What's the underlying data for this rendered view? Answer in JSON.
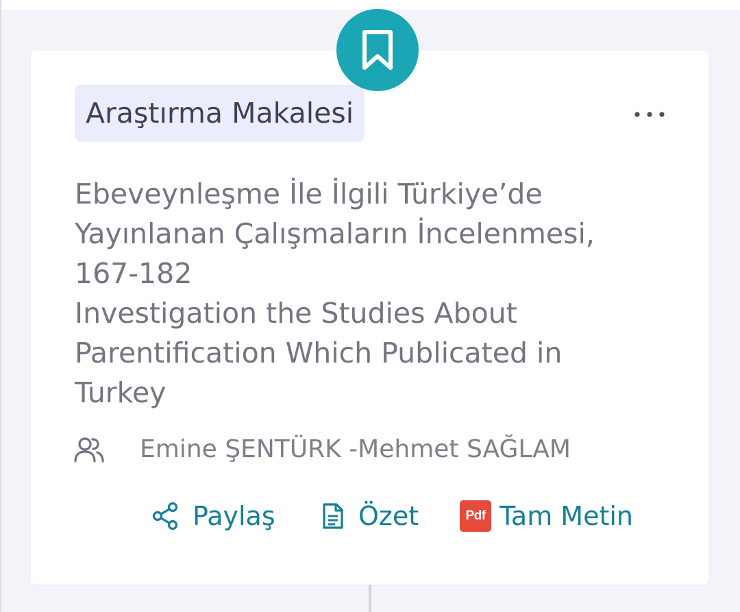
{
  "card": {
    "type_badge": "Araştırma Makalesi",
    "title_lines": [
      "Ebeveynleşme İle İlgili Türkiye’de",
      "Yayınlanan Çalışmaların İncelenmesi,",
      "167-182",
      "Investigation the Studies About",
      "Parentification Which Publicated in",
      "Turkey"
    ],
    "authors": "Emine ŞENTÜRK -Mehmet SAĞLAM",
    "actions": {
      "share_label": "Paylaş",
      "abstract_label": "Özet",
      "fulltext_label": "Tam Metin",
      "pdf_badge_text": "Pdf"
    },
    "icons": {
      "bookmark": "bookmark-icon",
      "more": "more-horizontal-icon",
      "authors": "users-icon",
      "share": "share-icon",
      "abstract": "document-icon",
      "fulltext": "pdf-icon"
    }
  },
  "colors": {
    "accent_teal": "#1ba6b6",
    "link_teal": "#157f98",
    "badge_bg": "#eaedfb",
    "pdf_red": "#e64a3c",
    "page_bg": "#f3f4f9"
  }
}
